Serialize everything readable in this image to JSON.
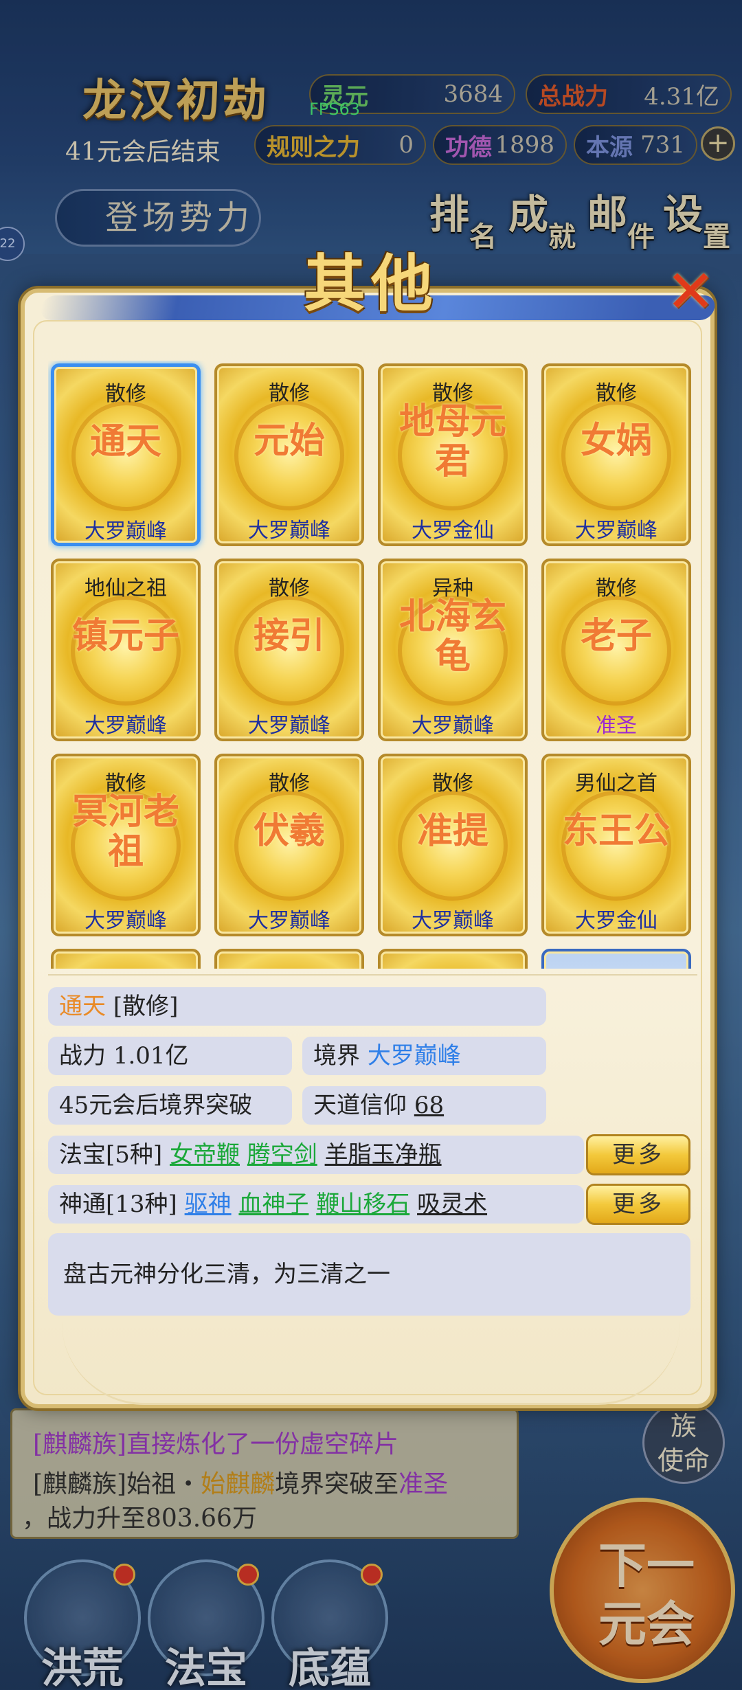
{
  "hud": {
    "era_title": "龙汉初劫",
    "era_subtitle": "41元会后结束",
    "fps": "FPS63",
    "stats": {
      "lingyuan_label": "灵元",
      "lingyuan_value": "3684",
      "power_label": "总战力",
      "power_value": "4.31亿",
      "rule_label": "规则之力",
      "rule_value": "0",
      "merit_label": "功德",
      "merit_value": "1898",
      "origin_label": "本源",
      "origin_value": "731"
    },
    "plus_label": "+",
    "faction_button": "登场势力",
    "side_tag": "22",
    "menu": [
      {
        "a": "排",
        "b": "名"
      },
      {
        "a": "成",
        "b": "就"
      },
      {
        "a": "邮",
        "b": "件"
      },
      {
        "a": "设",
        "b": "置"
      }
    ]
  },
  "log": {
    "line1_prefix": "[麒麟族]",
    "line1_text": "直接炼化了一份虚空碎片",
    "line2_a": "[麒麟族]始祖・",
    "line2_name": "始麒麟",
    "line2_b": "境界突破至",
    "line2_realm": "准圣",
    "line3": "，战力升至803.66万"
  },
  "clan_button": "族使命",
  "clan_button_parts": [
    "族",
    "使命"
  ],
  "bottom_nav": [
    "洪荒",
    "法宝",
    "底蕴"
  ],
  "next_button": [
    "下一",
    "元会"
  ],
  "modal": {
    "title": "其他",
    "close": "✕",
    "cards": [
      {
        "type": "散修",
        "name": "通天",
        "realm": "大罗巅峰"
      },
      {
        "type": "散修",
        "name": "元始",
        "realm": "大罗巅峰"
      },
      {
        "type": "散修",
        "name": "地母元君",
        "realm": "大罗金仙"
      },
      {
        "type": "散修",
        "name": "女娲",
        "realm": "大罗巅峰"
      },
      {
        "type": "地仙之祖",
        "name": "镇元子",
        "realm": "大罗巅峰"
      },
      {
        "type": "散修",
        "name": "接引",
        "realm": "大罗巅峰"
      },
      {
        "type": "异种",
        "name": "北海玄龟",
        "realm": "大罗巅峰"
      },
      {
        "type": "散修",
        "name": "老子",
        "realm": "准圣"
      },
      {
        "type": "散修",
        "name": "冥河老祖",
        "realm": "大罗巅峰"
      },
      {
        "type": "散修",
        "name": "伏羲",
        "realm": "大罗巅峰"
      },
      {
        "type": "散修",
        "name": "准提",
        "realm": "大罗巅峰"
      },
      {
        "type": "男仙之首",
        "name": "东王公",
        "realm": "大罗金仙"
      }
    ],
    "detail": {
      "name": "通天",
      "type": "[散修]",
      "power_label": "战力",
      "power_value": "1.01亿",
      "realm_label": "境界",
      "realm_value": "大罗巅峰",
      "breakthrough": "45元会后境界突破",
      "faith_label": "天道信仰",
      "faith_value": "68",
      "treasure_label": "法宝[5种]",
      "treasures": [
        "女帝鞭",
        "腾空剑",
        "羊脂玉净瓶"
      ],
      "skill_label": "神通[13种]",
      "skills": [
        "驱神",
        "血神子",
        "鞭山移石",
        "吸灵术"
      ],
      "more_label": "更多",
      "description": "盘古元神分化三清，为三清之一"
    }
  }
}
